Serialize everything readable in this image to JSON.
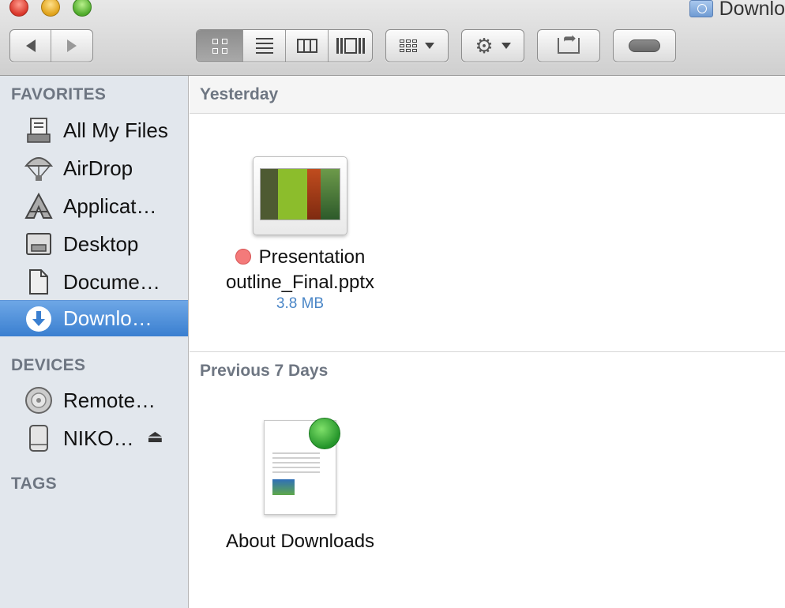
{
  "window": {
    "title": "Downlo"
  },
  "sidebar": {
    "sections": {
      "favorites": "FAVORITES",
      "devices": "DEVICES",
      "tags": "TAGS"
    },
    "favorites": [
      {
        "label": "All My Files",
        "icon": "all-files-icon"
      },
      {
        "label": "AirDrop",
        "icon": "airdrop-icon"
      },
      {
        "label": "Applicat…",
        "icon": "applications-icon"
      },
      {
        "label": "Desktop",
        "icon": "desktop-icon"
      },
      {
        "label": "Docume…",
        "icon": "documents-icon"
      },
      {
        "label": "Downlo…",
        "icon": "downloads-icon",
        "selected": true
      }
    ],
    "devices": [
      {
        "label": "Remote…",
        "icon": "remote-disc-icon"
      },
      {
        "label": "NIKO…",
        "icon": "external-drive-icon",
        "eject": "⏏"
      }
    ]
  },
  "main": {
    "groups": [
      {
        "title": "Yesterday",
        "files": [
          {
            "name_line1": "Presentation",
            "name_line2": "outline_Final.pptx",
            "size": "3.8 MB",
            "tag_color": "#f47a7a"
          }
        ]
      },
      {
        "title": "Previous 7 Days",
        "files": [
          {
            "name_line1": "About Downloads"
          }
        ]
      }
    ]
  },
  "colors": {
    "selection": "#3a7fd0",
    "size_text": "#4a86c7",
    "section_header": "#6e7682"
  }
}
